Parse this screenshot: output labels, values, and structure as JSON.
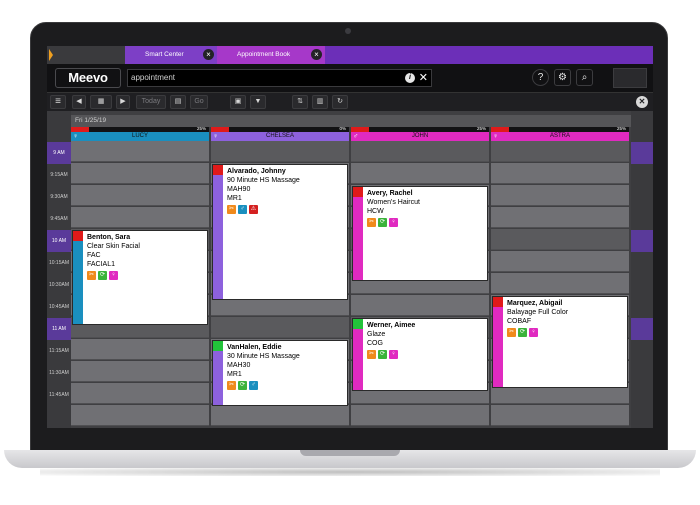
{
  "tabs": [
    {
      "label": "Smart Center"
    },
    {
      "label": "Appointment Book"
    }
  ],
  "header": {
    "logo": "Meevo",
    "search_value": "appointment",
    "icons": [
      "help-icon",
      "user-settings-icon",
      "search-icon"
    ]
  },
  "toolbar": {
    "today_label": "Today",
    "go_label": "Go"
  },
  "calendar": {
    "date": "Fri 1/25/19",
    "times": [
      "9 AM",
      "9:15AM",
      "9:30AM",
      "9:45AM",
      "10 AM",
      "10:15AM",
      "10:30AM",
      "10:45AM",
      "11 AM",
      "11:15AM",
      "11:30AM",
      "11:45AM"
    ],
    "providers": [
      {
        "name": "LUCY",
        "percent": "25%",
        "color": "#1a8fbf",
        "gender": "♀"
      },
      {
        "name": "CHELSEA",
        "percent": "0%",
        "color": "#8d61dd",
        "gender": "♀"
      },
      {
        "name": "JOHN",
        "percent": "25%",
        "color": "#e02ac0",
        "gender": "♂"
      },
      {
        "name": "ASTRA",
        "percent": "25%",
        "color": "#e02ac0",
        "gender": "♀"
      }
    ],
    "appointments": [
      {
        "client": "Benton, Sara",
        "service": "Clear Skin Facial",
        "code": "FAC",
        "resource": "FACIAL1",
        "strip_color": "#1a8fbf",
        "flag_color": "#e01a1a"
      },
      {
        "client": "Alvarado, Johnny",
        "service": "90 Minute HS Massage",
        "code": "MAH90",
        "resource": "MR1",
        "strip_color": "#8d61dd",
        "flag_color": "#e01a1a"
      },
      {
        "client": "VanHalen, Eddie",
        "service": "30 Minute HS Massage",
        "code": "MAH30",
        "resource": "MR1",
        "strip_color": "#8d61dd",
        "flag_color": "#22c33a"
      },
      {
        "client": "Avery, Rachel",
        "service": "Women's Haircut",
        "code": "HCW",
        "strip_color": "#e02ac0",
        "flag_color": "#e01a1a"
      },
      {
        "client": "Werner, Aimee",
        "service": "Glaze",
        "code": "COG",
        "strip_color": "#e02ac0",
        "flag_color": "#22c33a"
      },
      {
        "client": "Marquez, Abigail",
        "service": "Balayage Full Color",
        "code": "COBAF",
        "strip_color": "#e02ac0",
        "flag_color": "#e01a1a"
      }
    ]
  }
}
